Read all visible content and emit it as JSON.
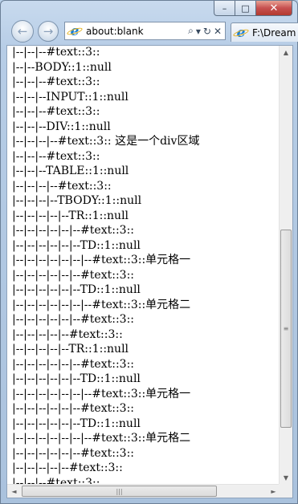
{
  "window": {
    "minimize_glyph": "–",
    "maximize_glyph": "□",
    "close_glyph": "✕"
  },
  "nav": {
    "back_glyph": "←",
    "forward_glyph": "→"
  },
  "address_bar": {
    "url": "about:blank",
    "search_icon": "⌕",
    "dropdown_icon": "▾",
    "refresh_icon": "↻",
    "stop_icon": "✕"
  },
  "tab": {
    "title": "F:\\Dream"
  },
  "content": {
    "lines": [
      "|--|--|--#text::3::",
      "|--|--BODY::1::null",
      "|--|--|--#text::3::",
      "|--|--|--INPUT::1::null",
      "|--|--|--#text::3::",
      "|--|--|--DIV::1::null",
      "|--|--|--|--#text::3:: 这是一个div区域",
      "|--|--|--#text::3::",
      "|--|--|--TABLE::1::null",
      "|--|--|--|--#text::3::",
      "|--|--|--|--TBODY::1::null",
      "|--|--|--|--|--TR::1::null",
      "|--|--|--|--|--|--#text::3::",
      "|--|--|--|--|--|--TD::1::null",
      "|--|--|--|--|--|--|--#text::3::单元格一",
      "|--|--|--|--|--|--#text::3::",
      "|--|--|--|--|--|--TD::1::null",
      "|--|--|--|--|--|--|--#text::3::单元格二",
      "|--|--|--|--|--|--#text::3::",
      "|--|--|--|--|--#text::3::",
      "|--|--|--|--|--TR::1::null",
      "|--|--|--|--|--|--#text::3::",
      "|--|--|--|--|--|--TD::1::null",
      "|--|--|--|--|--|--|--#text::3::单元格一",
      "|--|--|--|--|--|--#text::3::",
      "|--|--|--|--|--|--TD::1::null",
      "|--|--|--|--|--|--|--#text::3::单元格二",
      "|--|--|--|--|--|--#text::3::",
      "|--|--|--|--|--#text::3::",
      "|--|--|--#text::3::"
    ]
  },
  "scrollbars": {
    "up_glyph": "▲",
    "down_glyph": "▼",
    "left_glyph": "◄",
    "right_glyph": "►",
    "grip_v": "≡",
    "grip_h": "|||"
  }
}
